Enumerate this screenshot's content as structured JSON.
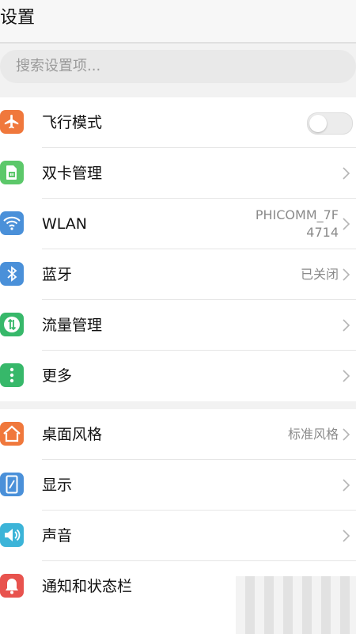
{
  "header": {
    "title": "设置"
  },
  "search": {
    "placeholder": "搜索设置项..."
  },
  "colors": {
    "airplane": "#f0783c",
    "sim": "#5cc86a",
    "wlan": "#4a90d9",
    "bluetooth": "#4a90d9",
    "data": "#37b86a",
    "more": "#37b86a",
    "home": "#f0783c",
    "display": "#4a90d9",
    "sound": "#3cb4d8",
    "notification": "#e8534e"
  },
  "group1": {
    "airplane": {
      "label": "飞行模式",
      "toggle_on": false
    },
    "sim": {
      "label": "双卡管理"
    },
    "wlan": {
      "label": "WLAN",
      "value_line1": "PHICOMM_7F",
      "value_line2": "4714"
    },
    "bluetooth": {
      "label": "蓝牙",
      "value": "已关闭"
    },
    "data": {
      "label": "流量管理"
    },
    "more": {
      "label": "更多"
    }
  },
  "group2": {
    "home": {
      "label": "桌面风格",
      "value": "标准风格"
    },
    "display": {
      "label": "显示"
    },
    "sound": {
      "label": "声音"
    },
    "notification": {
      "label": "通知和状态栏"
    }
  }
}
